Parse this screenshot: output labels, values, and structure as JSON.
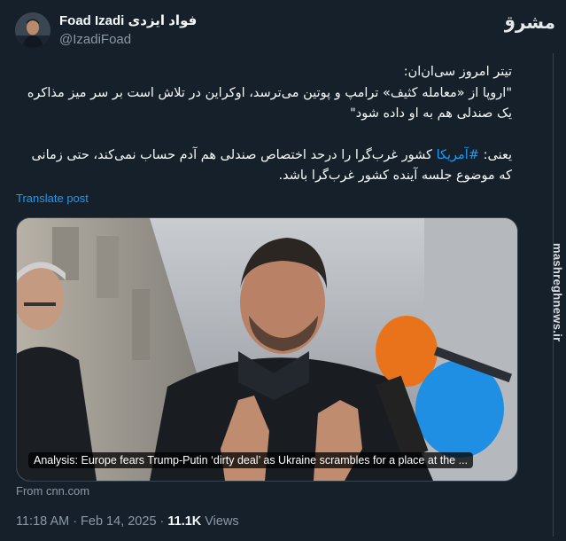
{
  "author": {
    "name": "Foad Izadi فواد ایزدی",
    "handle": "@IzadiFoad"
  },
  "post": {
    "line1": "تیتر امروز سی‌ان‌ان:",
    "line2": "\"اروپا از «معامله کثیف» ترامپ و پوتین می‌ترسد، اوکراین در تلاش است بر سر میز مذاکره یک صندلی هم به او داده شود\"",
    "line3_prefix": "یعنی:",
    "hashtag": "#آمریکا",
    "line3_rest": "کشور غرب‌گرا را درحد اختصاص صندلی هم آدم حساب نمی‌کند، حتی زمانی که موضوع جلسه آینده کشور غرب‌گرا باشد."
  },
  "translate_label": "Translate post",
  "card": {
    "caption": "Analysis: Europe fears Trump-Putin ‘dirty deal’ as Ukraine scrambles for a place at the ..."
  },
  "source": "From cnn.com",
  "meta": {
    "time": "11:18 AM",
    "separator": "·",
    "date": "Feb 14, 2025",
    "views_count": "11.1K",
    "views_label": "Views"
  },
  "watermark": {
    "logo_text": "مشرق",
    "side_text": "mashreghnews.ir"
  },
  "colors": {
    "background": "#15202b",
    "link": "#1d9bf0",
    "muted": "#8b98a5"
  }
}
